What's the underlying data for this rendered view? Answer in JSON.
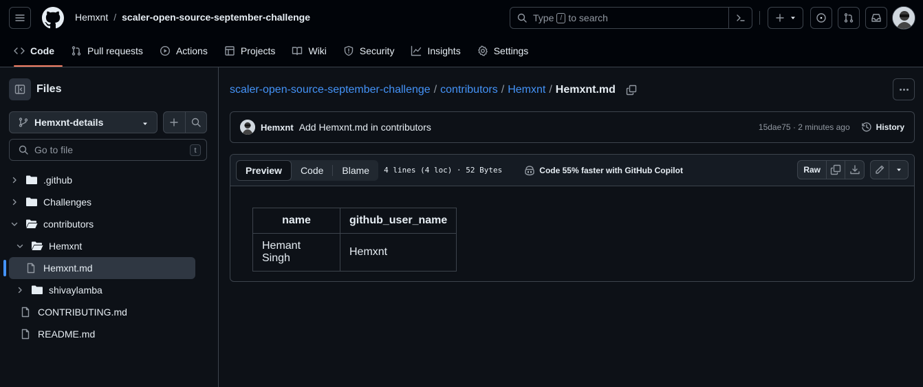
{
  "header": {
    "owner": "Hemxnt",
    "separator": "/",
    "repo": "scaler-open-source-september-challenge",
    "search": {
      "prefix": "Type",
      "key": "/",
      "suffix": "to search"
    }
  },
  "repo_nav": {
    "tabs": [
      {
        "label": "Code",
        "icon": "code-icon"
      },
      {
        "label": "Pull requests",
        "icon": "pull-request-icon"
      },
      {
        "label": "Actions",
        "icon": "play-icon"
      },
      {
        "label": "Projects",
        "icon": "table-icon"
      },
      {
        "label": "Wiki",
        "icon": "book-icon"
      },
      {
        "label": "Security",
        "icon": "shield-icon"
      },
      {
        "label": "Insights",
        "icon": "graph-icon"
      },
      {
        "label": "Settings",
        "icon": "gear-icon"
      }
    ]
  },
  "sidebar": {
    "title": "Files",
    "branch": "Hemxnt-details",
    "goto_placeholder": "Go to file",
    "goto_key": "t",
    "tree": [
      {
        "label": ".github",
        "type": "folder",
        "expanded": false
      },
      {
        "label": "Challenges",
        "type": "folder",
        "expanded": false
      },
      {
        "label": "contributors",
        "type": "folder",
        "expanded": true
      },
      {
        "label": "Hemxnt",
        "type": "folder",
        "expanded": true
      },
      {
        "label": "Hemxnt.md",
        "type": "file",
        "selected": true
      },
      {
        "label": "shivaylamba",
        "type": "folder",
        "expanded": false
      },
      {
        "label": "CONTRIBUTING.md",
        "type": "file"
      },
      {
        "label": "README.md",
        "type": "file"
      }
    ]
  },
  "main": {
    "path": {
      "repo": "scaler-open-source-september-challenge",
      "dir1": "contributors",
      "dir2": "Hemxnt",
      "file": "Hemxnt.md",
      "sep": "/"
    },
    "commit": {
      "author": "Hemxnt",
      "message": "Add Hemxnt.md in contributors",
      "meta": "15dae75 · 2 minutes ago",
      "history_label": "History"
    },
    "file": {
      "tabs": {
        "preview": "Preview",
        "code": "Code",
        "blame": "Blame"
      },
      "info": "4 lines (4 loc) · 52 Bytes",
      "copilot": "Code 55% faster with GitHub Copilot",
      "raw": "Raw"
    },
    "table": {
      "headers": [
        "name",
        "github_user_name"
      ],
      "rows": [
        [
          "Hemant Singh",
          "Hemxnt"
        ]
      ]
    }
  },
  "colors": {
    "background": "#0d1117",
    "header_bg": "#010409",
    "accent_link": "#4493f8",
    "tab_underline": "#f78166",
    "border": "#3d444d"
  }
}
